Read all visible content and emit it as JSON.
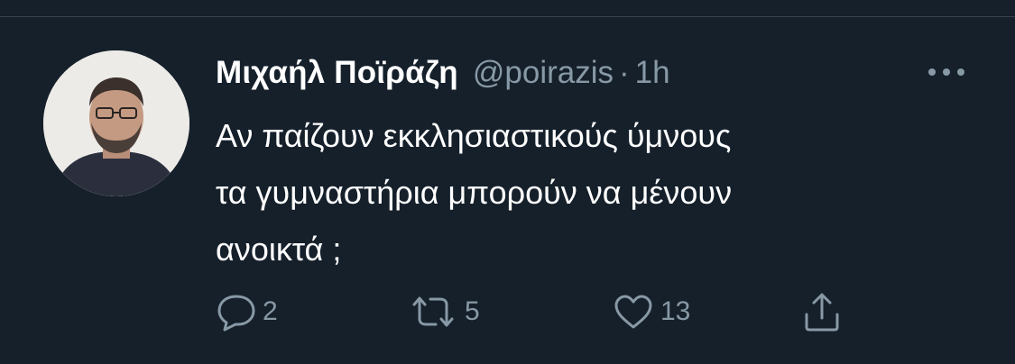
{
  "tweet": {
    "display_name": "Μιχαήλ Ποϊράζη",
    "handle": "@poirazis",
    "separator": "·",
    "time": "1h",
    "text": "Αν παίζουν εκκλησιαστικούς ύμνους\nτα γυμναστήρια μπορούν να μένουν\nανοικτά ;",
    "avatar_icon": "profile-photo",
    "more_icon": "more-dots-icon"
  },
  "actions": {
    "reply_count": "2",
    "retweet_count": "5",
    "like_count": "13",
    "reply_icon": "reply-icon",
    "retweet_icon": "retweet-icon",
    "like_icon": "heart-icon",
    "share_icon": "share-icon"
  },
  "colors": {
    "background": "#15202b",
    "primary_text": "#ffffff",
    "secondary_text": "#8899a6",
    "divider": "#38444d"
  }
}
